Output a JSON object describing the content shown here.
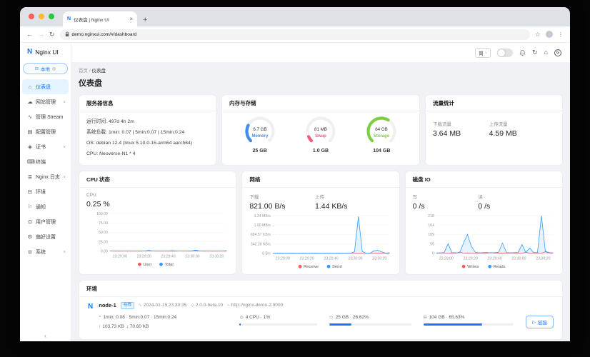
{
  "browser": {
    "tab_title": "仪表盘 | Nginx UI",
    "url": "demo.nginxui.com/#/dashboard"
  },
  "header": {
    "lang": "简"
  },
  "sidebar": {
    "brand_letter": "N",
    "brand": "Nginx UI",
    "env_switcher": "本地",
    "items": [
      {
        "label": "仪表盘",
        "icon": "dashboard",
        "active": true,
        "chevron": false
      },
      {
        "label": "网站管理",
        "icon": "site",
        "active": false,
        "chevron": true
      },
      {
        "label": "管理 Stream",
        "icon": "stream",
        "active": false,
        "chevron": false
      },
      {
        "label": "配置管理",
        "icon": "config",
        "active": false,
        "chevron": false
      },
      {
        "label": "证书",
        "icon": "certificate",
        "active": false,
        "chevron": true
      },
      {
        "label": "终端",
        "icon": "terminal",
        "active": false,
        "chevron": false
      },
      {
        "label": "Nginx 日志",
        "icon": "logs",
        "active": false,
        "chevron": true
      },
      {
        "label": "环境",
        "icon": "environment",
        "active": false,
        "chevron": false
      },
      {
        "label": "通知",
        "icon": "notification",
        "active": false,
        "chevron": false
      },
      {
        "label": "用户管理",
        "icon": "user",
        "active": false,
        "chevron": false
      },
      {
        "label": "偏好设置",
        "icon": "settings",
        "active": false,
        "chevron": false
      },
      {
        "label": "系统",
        "icon": "system",
        "active": false,
        "chevron": true
      }
    ]
  },
  "page": {
    "breadcrumb_home": "首页",
    "breadcrumb_sep": "/",
    "breadcrumb_current": "仪表盘",
    "title": "仪表盘"
  },
  "server_info": {
    "title": "服务器信息",
    "lines": [
      "运行时间: 497d 4h 2m",
      "系统负载: 1min: 0.07 | 5min:0.07 | 15min:0.24",
      "OS: debian 12.4 (linux 5.10.0-15-arm64 aarch64)",
      "CPU: Neoverse-N1 * 4"
    ]
  },
  "memory_storage": {
    "title": "内存与存储",
    "gauges": [
      {
        "name": "Memory",
        "used": "6.7 GB",
        "total": "25 GB",
        "percent": 26.8,
        "color": "#418bec"
      },
      {
        "name": "Swap",
        "used": "81 MB",
        "total": "1.0 GB",
        "percent": 7.9,
        "color": "#f2597f"
      },
      {
        "name": "Storage",
        "used": "64 GB",
        "total": "104 GB",
        "percent": 61.5,
        "color": "#7ece43"
      }
    ]
  },
  "traffic": {
    "title": "流量统计",
    "download_label": "下载流量",
    "download_value": "3.64 MB",
    "upload_label": "上传流量",
    "upload_value": "4.59 MB"
  },
  "cpu_card": {
    "title": "CPU 状态",
    "stat_label": "CPU",
    "stat_value": "0.25 %"
  },
  "network_card": {
    "title": "网络",
    "download_label": "下载",
    "download_value": "821.00 B/s",
    "upload_label": "上传",
    "upload_value": "1.44 KB/s"
  },
  "disk_card": {
    "title": "磁盘 IO",
    "write_label": "写",
    "write_value": "0 /s",
    "read_label": "读",
    "read_value": "0 /s"
  },
  "environment": {
    "title": "环境",
    "node": {
      "icon_letter": "N",
      "name": "node-1",
      "status": "在线",
      "checked_at": "2024-01-15 23:30:35",
      "version": "2.0.0-beta.10",
      "url": "http://nginx-demo-2:9000",
      "load_avg": "1min: 0.08 · 5min:0.07 · 15min:0.24",
      "net_up": "↑ 103.73 KB",
      "net_down": "↓ 70.60 KB",
      "cpu_text": "4 CPU · 1%",
      "cpu_percent": 1,
      "mem_text": "25 GB · 26.62%",
      "mem_percent": 26.62,
      "disk_text": "104 GB · 65.63%",
      "disk_percent": 65.63,
      "connect_label": "链接"
    }
  },
  "chart_data": [
    {
      "type": "area",
      "title": "CPU 状态",
      "ymax": 100,
      "y_ticks": [
        "0.00",
        "25.00",
        "50.00",
        "75.00",
        "100.00"
      ],
      "x_ticks": [
        "23:29:00",
        "23:29:20",
        "23:29:40",
        "23:30:00",
        "23:30:20"
      ],
      "legend_position": "bottom",
      "series": [
        {
          "name": "User",
          "color": "#fa5a5a",
          "values": [
            0.3,
            0.2,
            0.3,
            0.2,
            0.3,
            0.2,
            0.2,
            0.3,
            0.2,
            0.3,
            0.6,
            0.3,
            0.2,
            0.3,
            0.2,
            0.2,
            0.4,
            0.2,
            0.3,
            0.2,
            0.3,
            0.2,
            0.6,
            0.3,
            0.2,
            0.3,
            0.2,
            0.3,
            0.2,
            0.3,
            0.2
          ]
        },
        {
          "name": "Total",
          "color": "#2f9bff",
          "values": [
            0.5,
            0.4,
            0.5,
            0.4,
            0.6,
            0.5,
            0.4,
            0.5,
            0.6,
            0.5,
            2.2,
            0.6,
            0.5,
            0.4,
            0.5,
            0.6,
            1.6,
            0.5,
            0.4,
            0.5,
            0.6,
            0.5,
            2.8,
            0.8,
            0.5,
            0.6,
            0.5,
            0.4,
            0.6,
            0.5,
            1.2
          ]
        }
      ]
    },
    {
      "type": "area",
      "title": "网络",
      "ymax": 1370,
      "unit": "KB/s",
      "y_ticks": [
        "0 B/s",
        "342.28 KB/s",
        "684.57 KB/s",
        "1.00 MB/s",
        "1.34 MB/s"
      ],
      "x_ticks": [
        "23:29:00",
        "23:29:20",
        "23:29:40",
        "23:30:00",
        "23:30:20"
      ],
      "legend_position": "bottom",
      "series": [
        {
          "name": "Receive",
          "color": "#fa5a5a",
          "values": [
            1,
            0.6,
            0.8,
            0.6,
            1,
            0.8,
            0.6,
            0.8,
            1,
            0.6,
            0.8,
            1,
            0.6,
            0.8,
            0.6,
            1,
            0.8,
            0.6,
            0.8,
            0.6,
            1,
            2,
            6,
            2,
            1,
            0.8,
            2,
            3,
            1.5,
            0.8,
            0.6
          ]
        },
        {
          "name": "Send",
          "color": "#2f9bff",
          "values": [
            1,
            1,
            2,
            1,
            1,
            2,
            1,
            1,
            2,
            1,
            1,
            2,
            1,
            1,
            2,
            1,
            1,
            2,
            1,
            1,
            3,
            60,
            1340,
            70,
            3,
            3,
            90,
            110,
            55,
            8,
            20
          ]
        }
      ]
    },
    {
      "type": "area",
      "title": "磁盘 IO",
      "ymax": 218,
      "y_ticks": [
        "0",
        "55",
        "109",
        "164",
        "218"
      ],
      "x_ticks": [
        "23:29:00",
        "23:29:20",
        "23:29:40",
        "23:30:00",
        "23:30:20"
      ],
      "legend_position": "bottom",
      "series": [
        {
          "name": "Writes",
          "color": "#fa5a5a",
          "values": [
            1,
            2,
            1,
            1,
            2,
            1,
            8,
            1,
            2,
            1,
            1,
            2,
            1,
            1,
            5,
            1,
            1,
            2,
            1,
            1,
            2,
            1,
            1,
            6,
            1,
            1,
            2,
            1,
            9,
            2,
            1
          ]
        },
        {
          "name": "Reads",
          "color": "#2f9bff",
          "values": [
            2,
            3,
            4,
            55,
            5,
            3,
            4,
            60,
            110,
            40,
            6,
            3,
            4,
            5,
            3,
            4,
            6,
            60,
            5,
            3,
            4,
            5,
            50,
            6,
            30,
            4,
            5,
            218,
            12,
            4,
            3
          ]
        }
      ]
    }
  ]
}
